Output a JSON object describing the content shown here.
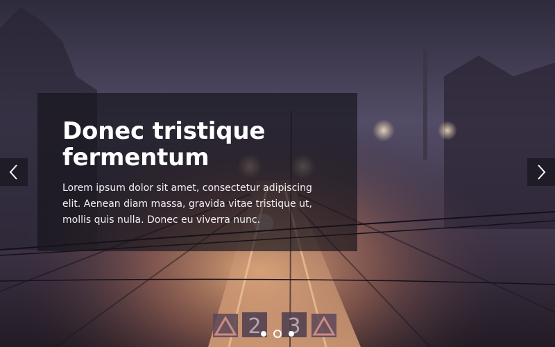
{
  "slide": {
    "title": "Donec tristique fermentum",
    "description": "Lorem ipsum dolor sit amet, consectetur adipiscing elit. Aenean diam massa, gravida vitae tristique ut, mollis quis nulla. Donec eu viverra nunc."
  },
  "background": {
    "sign_left": "2",
    "sign_right": "3"
  },
  "navigation": {
    "prev_icon": "chevron-left-icon",
    "next_icon": "chevron-right-icon",
    "dots_count": 3,
    "active_dot": 2
  },
  "colors": {
    "sky_top": "#3a3648",
    "sky_mid": "#56506a",
    "platform_glow": "#d99a6a",
    "caption_bg": "#16141c"
  }
}
